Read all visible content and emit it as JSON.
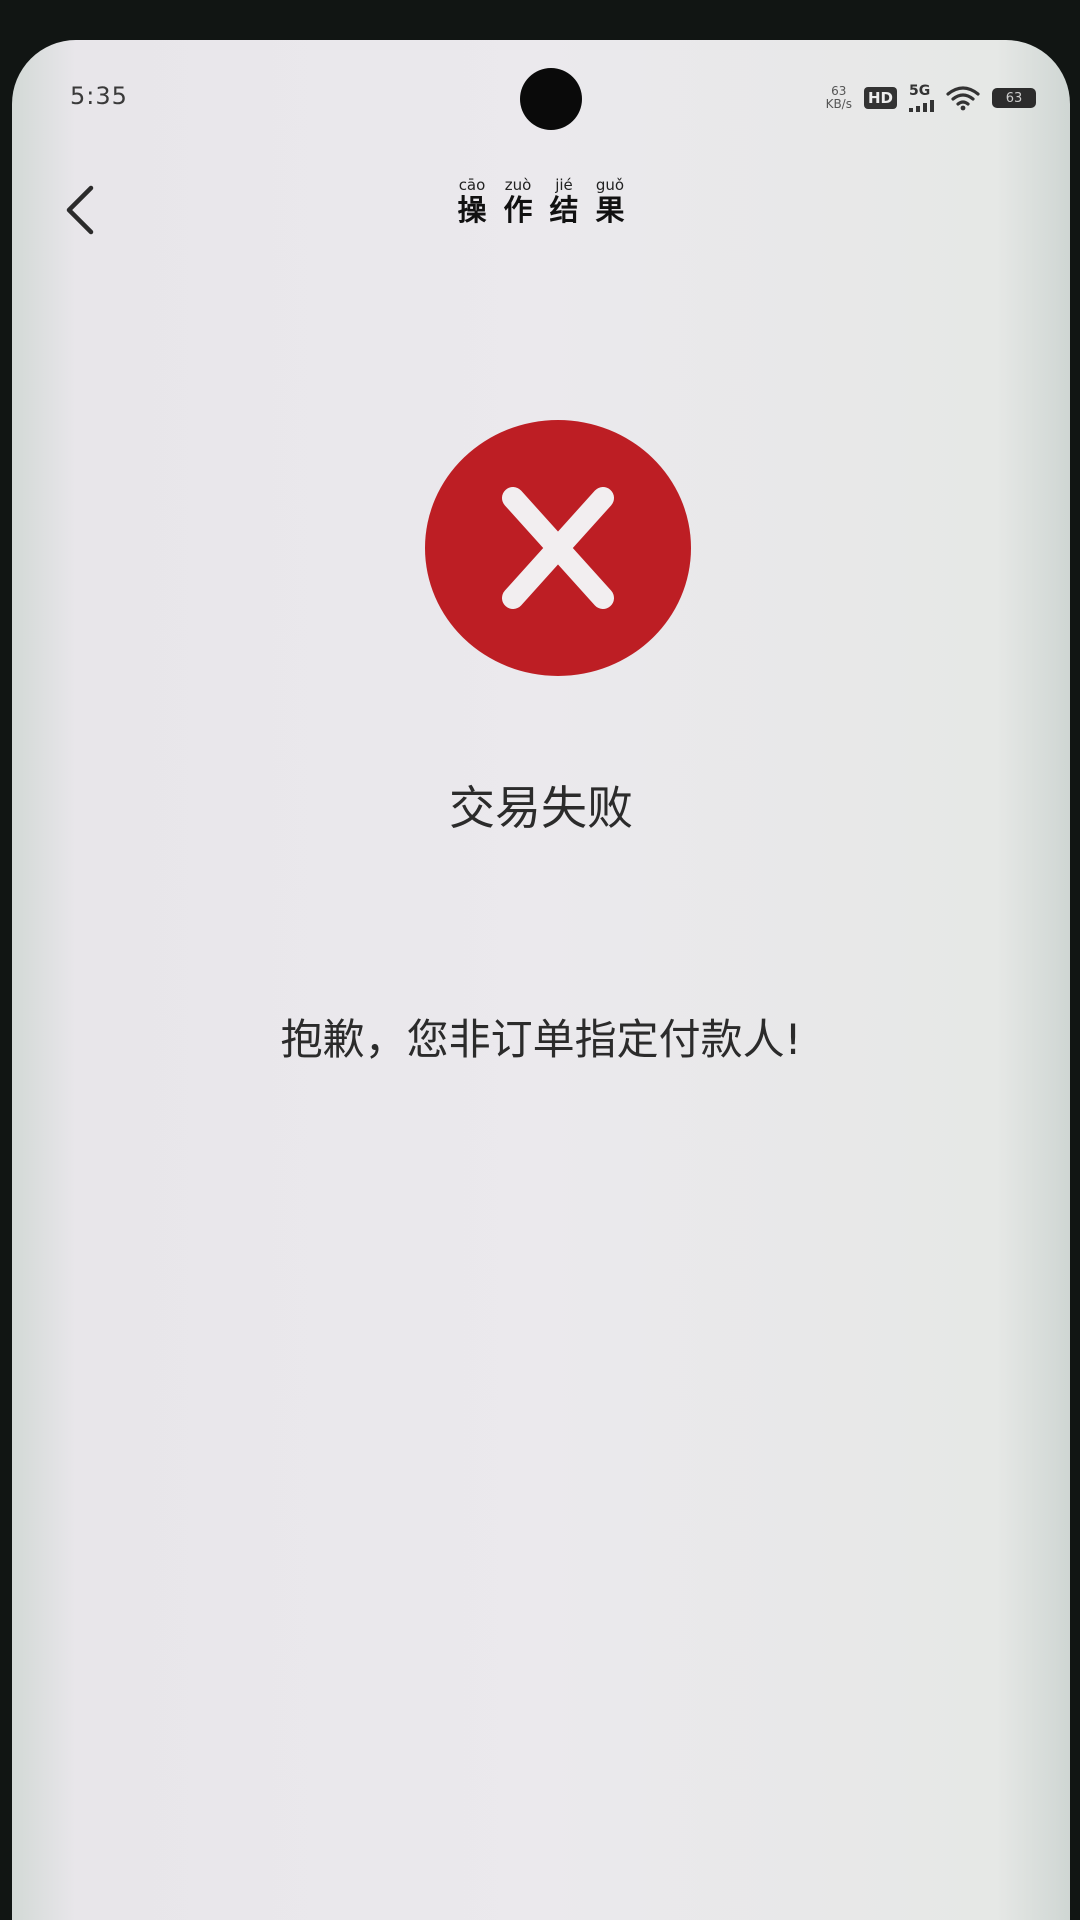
{
  "status_bar": {
    "time": "5:35",
    "net_speed_value": "63",
    "net_speed_unit": "KB/s",
    "hd_label": "HD",
    "network_label": "5G",
    "battery_level": "63"
  },
  "nav": {
    "back_icon": "chevron-left-icon",
    "title_chars": [
      {
        "pinyin": "cāo",
        "hanzi": "操"
      },
      {
        "pinyin": "zuò",
        "hanzi": "作"
      },
      {
        "pinyin": "jié",
        "hanzi": "结"
      },
      {
        "pinyin": "guǒ",
        "hanzi": "果"
      }
    ]
  },
  "result": {
    "icon": "error-x-icon",
    "icon_color": "#bd1e24",
    "title": "交易失败",
    "message": "抱歉，您非订单指定付款人!"
  }
}
